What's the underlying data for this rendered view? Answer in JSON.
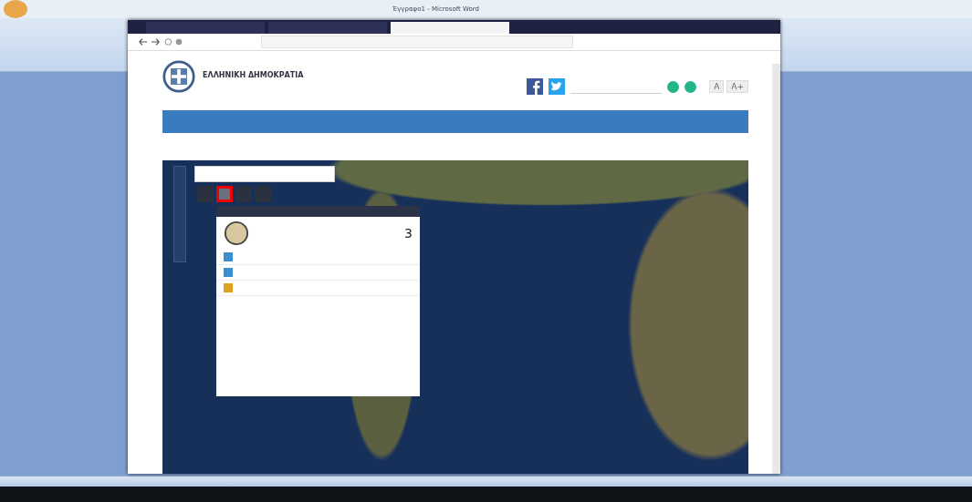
{
  "word_window": {
    "title": "Έγγραφο1 - Microsoft Word"
  },
  "browser": {
    "tabs": [
      {
        "selected": false
      },
      {
        "selected": false
      },
      {
        "selected": true
      }
    ]
  },
  "site": {
    "title": "ΕΛΛΗΝΙΚΗ ΔΗΜΟΚΡΑΤΙΑ",
    "font_buttons": [
      "A",
      "A+"
    ]
  },
  "map": {
    "popup": {
      "count": "3",
      "rows": [
        {
          "color": "#3a8fd0"
        },
        {
          "color": "#3a8fd0"
        },
        {
          "color": "#e0a020"
        }
      ]
    },
    "tools": [
      {
        "selected": false
      },
      {
        "selected": true
      },
      {
        "selected": false
      },
      {
        "selected": false
      }
    ]
  }
}
